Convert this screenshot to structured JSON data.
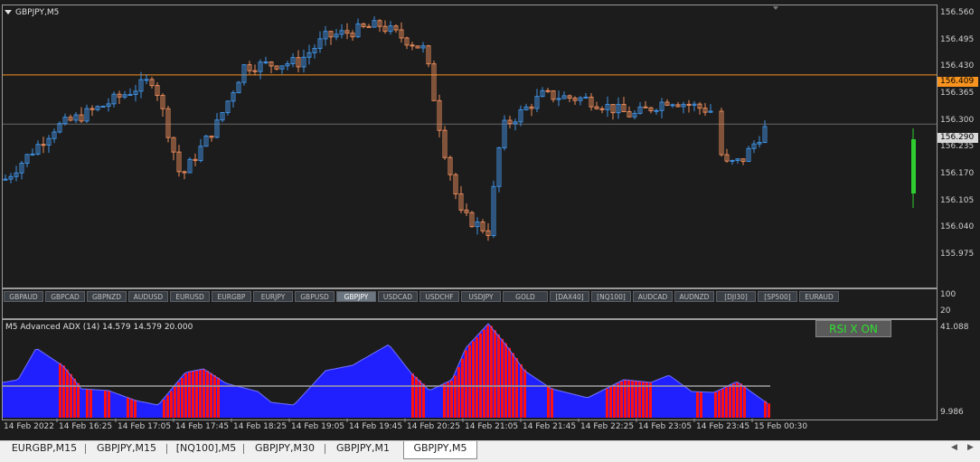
{
  "main_chart": {
    "title": "GBPJPY,M5",
    "price_ticks": [
      "156.560",
      "156.495",
      "156.430",
      "156.365",
      "156.300",
      "156.235",
      "156.170",
      "156.105",
      "156.040",
      "155.975"
    ],
    "level_line": {
      "value": 156.409,
      "label": "156.409",
      "color": "#f7931e"
    },
    "bid_line": {
      "value": 156.29,
      "label": "156.290"
    }
  },
  "symbols": [
    "GBPAUD",
    "GBPCAD",
    "GBPNZD",
    "AUDUSD",
    "EURUSD",
    "EURGBP",
    "EURJPY",
    "GBPUSD",
    "GBPJPY",
    "USDCAD",
    "USDCHF",
    "USDJPY",
    "GOLD",
    "[DAX40]",
    "[NQ100]",
    "AUDCAD",
    "AUDNZD",
    "[DJI30]",
    "[SP500]",
    "EURAUD"
  ],
  "active_symbol": "GBPJPY",
  "small_panel": {
    "ticks": [
      "100",
      "20"
    ]
  },
  "indicator": {
    "title": "M5 Advanced ADX (14) 14.579 14.579 20.000",
    "ticks": [
      "41.088",
      "9.986"
    ],
    "rsi_button": "RSI X ON",
    "colors": {
      "up": "#2020ff",
      "down": "#ff1010",
      "line": "#a0a0a0"
    }
  },
  "time_labels": [
    "14 Feb 2022",
    "14 Feb 16:25",
    "14 Feb 17:05",
    "14 Feb 17:45",
    "14 Feb 18:25",
    "14 Feb 19:05",
    "14 Feb 19:45",
    "14 Feb 20:25",
    "14 Feb 21:05",
    "14 Feb 21:45",
    "14 Feb 22:25",
    "14 Feb 23:05",
    "14 Feb 23:45",
    "15 Feb 00:30"
  ],
  "colors": {
    "bull": "#3f8fe0",
    "bear": "#e88a5a",
    "background": "#1c1c1c",
    "green_bar": "#2ecc2e"
  },
  "tabs": [
    "EURGBP,M15",
    "GBPJPY,M15",
    "[NQ100],M5",
    "GBPJPY,M30",
    "GBPJPY,M1",
    "GBPJPY,M5"
  ],
  "active_tab": "GBPJPY,M5"
}
